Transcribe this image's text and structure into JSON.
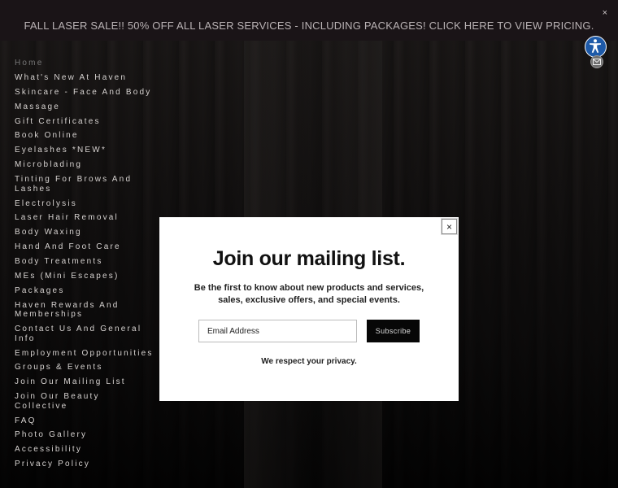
{
  "banner": {
    "text": "FALL LASER SALE!! 50% OFF ALL LASER SERVICES - INCLUDING PACKAGES! CLICK HERE TO VIEW PRICING.",
    "close": "×"
  },
  "nav": {
    "items": [
      "Home",
      "What's New At Haven",
      "Skincare - Face And Body",
      "Massage",
      "Gift Certificates",
      "Book Online",
      "Eyelashes *NEW*",
      "Microblading",
      "Tinting For Brows And Lashes",
      "Electrolysis",
      "Laser Hair Removal",
      "Body Waxing",
      "Hand And Foot Care",
      "Body Treatments",
      "MEs (Mini Escapes)",
      "Packages",
      "Haven Rewards And Memberships",
      "Contact Us And General Info",
      "Employment Opportunities",
      "Groups & Events",
      "Join Our Mailing List",
      "Join Our Beauty Collective",
      "FAQ",
      "Photo Gallery",
      "Accessibility",
      "Privacy Policy"
    ]
  },
  "modal": {
    "close": "×",
    "title": "Join our mailing list.",
    "subtitle": "Be the first to know about new products and services, sales, exclusive offers, and special events.",
    "email_placeholder": "Email Address",
    "subscribe_label": "Subscribe",
    "privacy": "We respect your privacy."
  },
  "icons": {
    "accessibility": "accessibility-icon",
    "mail": "mail-icon"
  },
  "colors": {
    "banner_bg": "#1a1417",
    "accessibility_blue": "#1e5aa8",
    "button_bg": "#070707"
  }
}
